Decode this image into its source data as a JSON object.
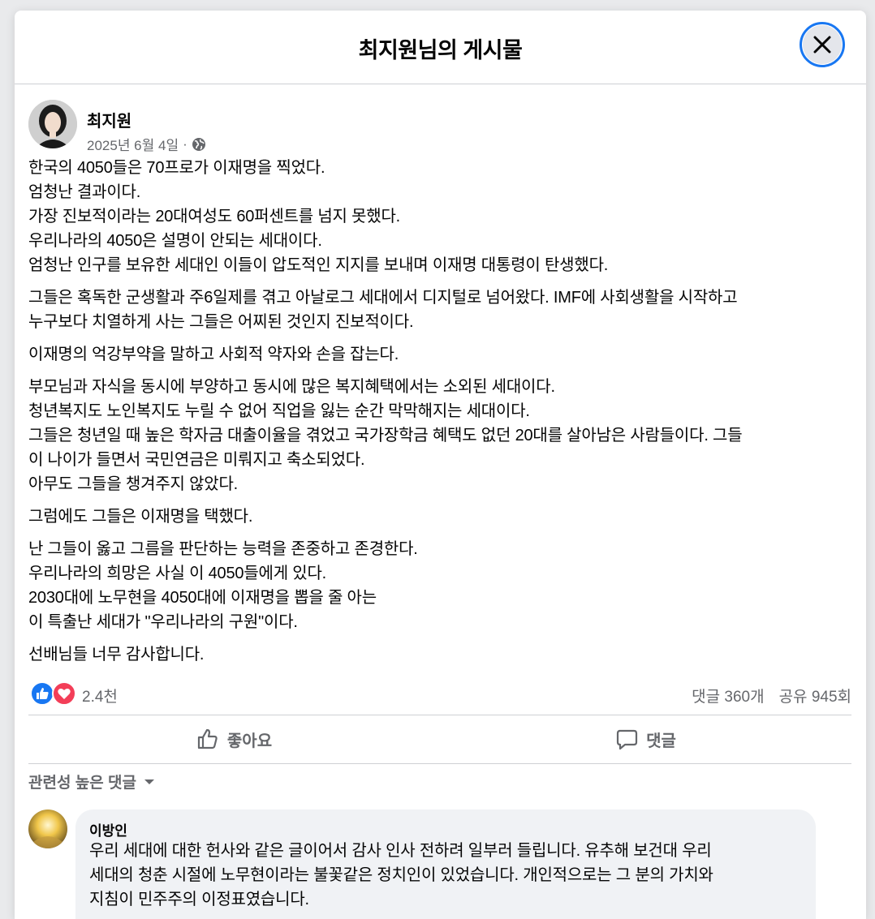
{
  "header": {
    "title": "최지원님의 게시물",
    "close_icon": "close-icon"
  },
  "post": {
    "author": "최지원",
    "date": "2025년 6월 4일",
    "separator": "·",
    "privacy_icon": "globe-icon",
    "paragraphs": [
      [
        "한국의 4050들은 70프로가 이재명을 찍었다.",
        "엄청난 결과이다.",
        "가장 진보적이라는 20대여성도 60퍼센트를 넘지 못했다.",
        "우리나라의 4050은 설명이 안되는 세대이다.",
        "엄청난 인구를 보유한 세대인 이들이 압도적인 지지를 보내며 이재명 대통령이 탄생했다."
      ],
      [
        "그들은 혹독한 군생활과 주6일제를 겪고 아날로그 세대에서 디지털로 넘어왔다. IMF에 사회생활을 시작하고",
        "누구보다 치열하게 사는 그들은 어찌된 것인지 진보적이다."
      ],
      [
        "이재명의 억강부약을 말하고 사회적 약자와 손을 잡는다."
      ],
      [
        "부모님과 자식을 동시에 부양하고 동시에 많은 복지혜택에서는 소외된 세대이다.",
        "청년복지도 노인복지도 누릴 수 없어 직업을 잃는 순간 막막해지는 세대이다.",
        "그들은 청년일 때 높은 학자금 대출이율을 겪었고 국가장학금 혜택도 없던 20대를 살아남은 사람들이다. 그들",
        "이 나이가 들면서 국민연금은 미뤄지고 축소되었다.",
        "아무도 그들을 챙겨주지 않았다."
      ],
      [
        "그럼에도 그들은 이재명을 택했다."
      ],
      [
        "난 그들이 옳고 그름을 판단하는 능력을 존중하고 존경한다.",
        "우리나라의 희망은 사실 이 4050들에게 있다.",
        "2030대에 노무현을 4050대에 이재명을 뽑을 줄 아는",
        "이 특출난 세대가 \"우리나라의 구원\"이다."
      ],
      [
        "선배님들 너무  감사합니다."
      ]
    ]
  },
  "reactions": {
    "count": "2.4천",
    "comments": "댓글 360개",
    "shares": "공유 945회",
    "icons": [
      "like-icon",
      "love-icon"
    ],
    "colors": {
      "like": "#1877f2",
      "love": "#f33e58"
    }
  },
  "actions": {
    "like_label": "좋아요",
    "comment_label": "댓글"
  },
  "comments_section": {
    "sort_label": "관련성 높은 댓글",
    "comments": [
      {
        "author": "이방인",
        "lines": [
          "우리 세대에 대한 헌사와 같은 글이어서 감사 인사 전하려 일부러 들립니다. 유추해 보건대 우리",
          "세대의 청춘 시절에 노무현이라는 불꽃같은 정치인이 있었습니다. 개인적으로는 그 분의 가치와",
          "지침이 민주주의 이정표였습니다."
        ]
      }
    ]
  }
}
